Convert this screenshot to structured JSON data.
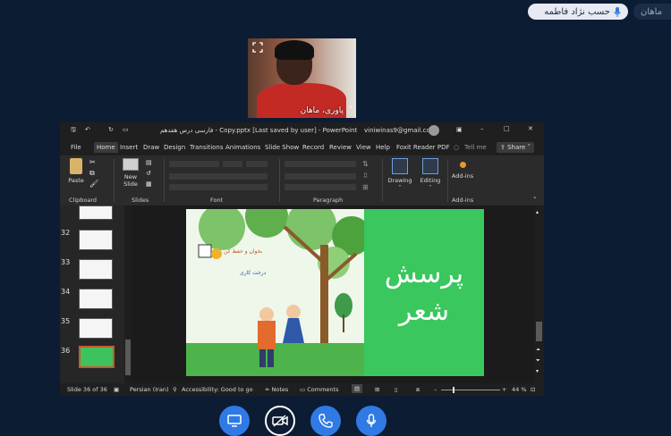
{
  "participants": {
    "active_speaker": "حسب نژاد فاطمه",
    "other": "ماهان"
  },
  "webcam": {
    "name": "پاوری، ماهان",
    "expand_icon": "expand-icon",
    "more_icon": "chevron-up-icon"
  },
  "powerpoint": {
    "title": "فارسی درس هفدهم - Copy.pptx [Last saved by user] - PowerPoint",
    "account_email": "viniwinas9@gmail.com",
    "tabs": [
      "File",
      "Home",
      "Insert",
      "Draw",
      "Design",
      "Transitions",
      "Animations",
      "Slide Show",
      "Record",
      "Review",
      "View",
      "Help",
      "Foxit Reader PDF"
    ],
    "tell_me": "Tell me",
    "share": "Share",
    "ribbon": {
      "paste": "Paste",
      "new_slide": "New Slide",
      "drawing": "Drawing",
      "editing": "Editing",
      "add_ins": "Add-ins",
      "groups": [
        "Clipboard",
        "Slides",
        "Font",
        "Paragraph",
        "Add-ins"
      ]
    },
    "thumbnails": [
      "32",
      "33",
      "34",
      "35",
      "36"
    ],
    "slide": {
      "title_lines": [
        "پرسش",
        "شعر"
      ],
      "book_title": "بخوان و حفظ کن",
      "poem_title": "درخت کاری"
    },
    "status": {
      "slide_count": "Slide 36 of 36",
      "language": "Persian (Iran)",
      "accessibility": "Accessibility: Good to go",
      "notes": "Notes",
      "comments": "Comments",
      "zoom": "44 %"
    }
  },
  "call_controls": [
    "screen-share",
    "video-off",
    "end-call",
    "microphone"
  ],
  "colors": {
    "background": "#0c1c33",
    "control_blue": "#2f7ae5",
    "slide_green": "#39c75e"
  }
}
